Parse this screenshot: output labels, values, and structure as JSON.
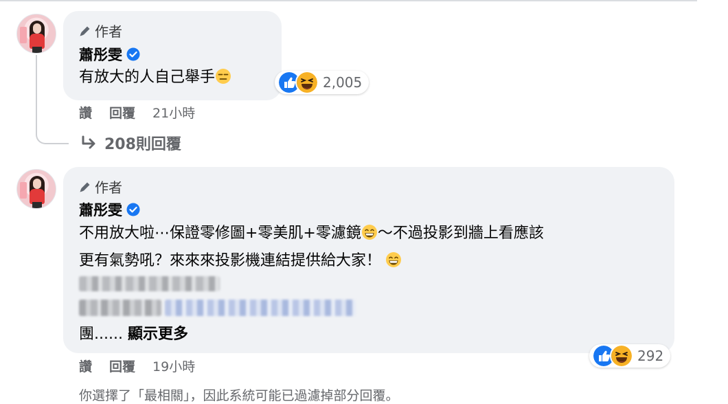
{
  "comments": [
    {
      "author_badge": "作者",
      "name": "蕭彤雯",
      "lines": [
        "有放大的人自己舉手"
      ],
      "reaction_count": "2,005",
      "actions": {
        "like": "讚",
        "reply": "回覆",
        "time": "21小時"
      },
      "replies_label": "208則回覆"
    },
    {
      "author_badge": "作者",
      "name": "蕭彤雯",
      "lines": [
        "不用放大啦⋯保證零修圖+零美肌+零濾鏡",
        "～不過投影到牆上看應該",
        "更有氣勢吼？來來來投影機連結提供給大家！"
      ],
      "truncated_prefix": "團......",
      "see_more": "顯示更多",
      "reaction_count": "292",
      "actions": {
        "like": "讚",
        "reply": "回覆",
        "time": "19小時"
      }
    }
  ],
  "filter_notice": "你選擇了「最相關」，因此系統可能已過濾掉部分回覆。",
  "icons": [
    "pencil-icon",
    "verified-icon",
    "like-reaction-icon",
    "haha-reaction-icon",
    "expressionless-emoji",
    "grinning-emoji",
    "reply-arrow-icon"
  ],
  "colors": {
    "bubble": "#f0f2f5",
    "verified": "#1877f2",
    "meta_text": "#65676b"
  }
}
